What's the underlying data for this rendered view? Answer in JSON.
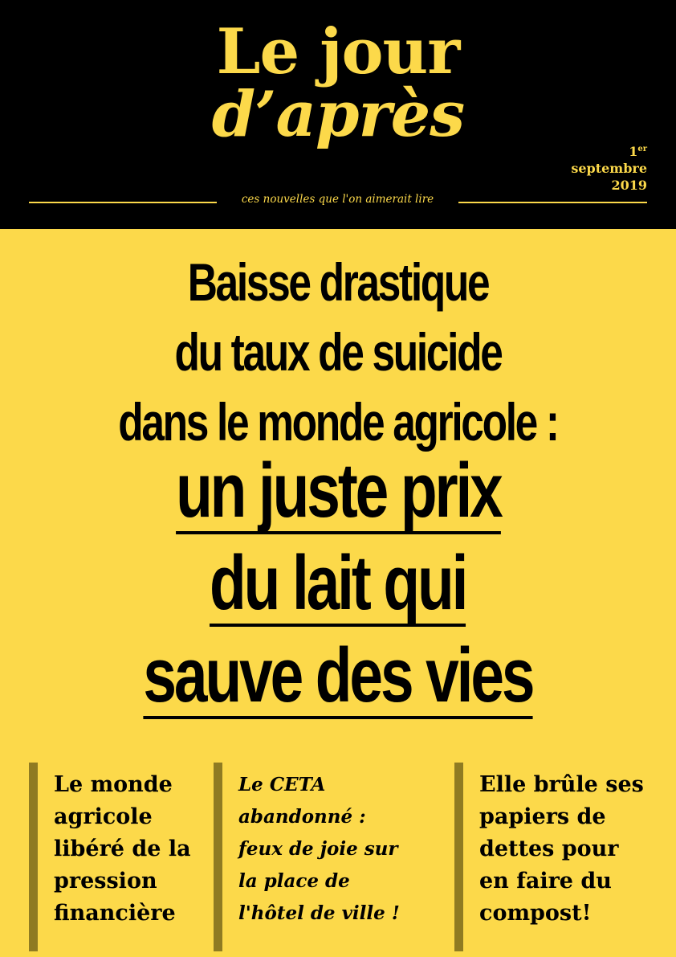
{
  "masthead": {
    "title_line1": "Le jour",
    "title_line2": "d’après",
    "date_day": "1",
    "date_day_suffix": "er",
    "date_month": "septembre",
    "date_year": "2019",
    "tagline": "ces nouvelles que l'on aimerait lire"
  },
  "headline": {
    "line1": "Baisse drastique",
    "line2": "du taux de suicide",
    "line3": "dans le monde agricole :",
    "big_line1": "un juste prix",
    "big_line2": "du lait qui",
    "big_line3": "sauve des vies"
  },
  "columns": [
    {
      "lines": [
        "Le monde",
        "agricole",
        "libéré de la",
        "pression",
        "financière"
      ]
    },
    {
      "lines": [
        "Le CETA",
        "abandonné :",
        "feux de joie sur",
        "la place de",
        "l'hôtel de ville !"
      ]
    },
    {
      "lines": [
        "Elle brûle ses",
        "papiers de",
        "dettes pour",
        "en faire du",
        "compost!"
      ]
    }
  ],
  "colors": {
    "background": "#fcd94a",
    "masthead": "#000000",
    "column_bar": "#8f7b22"
  }
}
